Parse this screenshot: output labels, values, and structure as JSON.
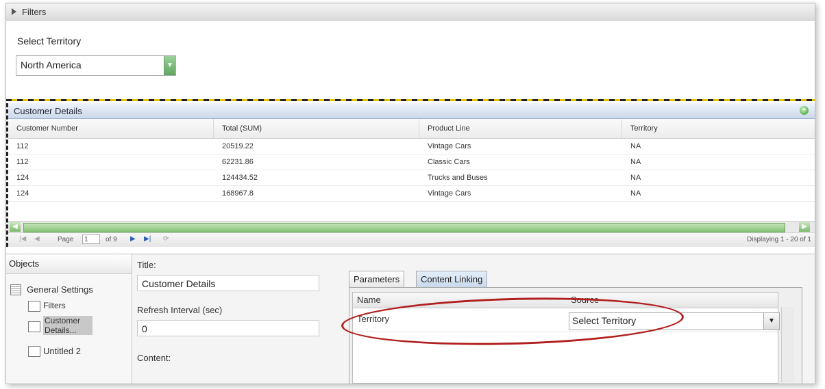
{
  "filters": {
    "header": "Filters",
    "label": "Select Territory",
    "value": "North America"
  },
  "grid": {
    "title": "Customer Details",
    "columns": [
      "Customer Number",
      "Total (SUM)",
      "Product Line",
      "Territory"
    ],
    "rows": [
      [
        "112",
        "20519.22",
        "Vintage Cars",
        "NA"
      ],
      [
        "112",
        "62231.86",
        "Classic Cars",
        "NA"
      ],
      [
        "124",
        "124434.52",
        "Trucks and Buses",
        "NA"
      ],
      [
        "124",
        "168967.8",
        "Vintage Cars",
        "NA"
      ]
    ],
    "pager": {
      "page_label": "Page",
      "page_value": "1",
      "of_label": "of 9",
      "display_text": "Displaying 1 - 20 of 1"
    }
  },
  "objects": {
    "header": "Objects",
    "items": [
      "General Settings",
      "Filters",
      "Customer Details...",
      "Untitled 2"
    ]
  },
  "settings": {
    "title_label": "Title:",
    "title_value": "Customer Details",
    "refresh_label": "Refresh Interval (sec)",
    "refresh_value": "0",
    "content_label": "Content:"
  },
  "tabs": {
    "items": [
      "Parameters",
      "Content Linking"
    ],
    "params": {
      "col_name": "Name",
      "col_source": "Source",
      "row_name": "Territory",
      "row_source": "Select Territory"
    }
  },
  "colors": {
    "highlight_ellipse": "#b21f1f",
    "scroll_green": "#86c174"
  }
}
